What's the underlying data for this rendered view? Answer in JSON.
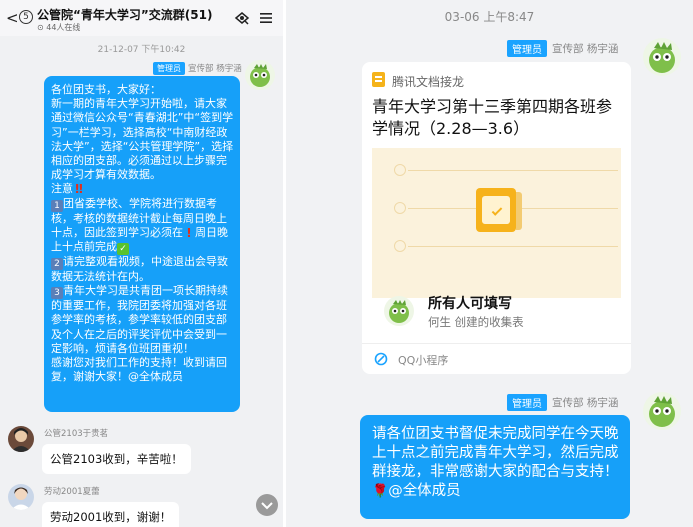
{
  "left": {
    "header": {
      "back_badge": "5",
      "group_title": "公管院“青年大学习”交流群(51)",
      "online_count": "44人在线",
      "back_glyph": "<"
    },
    "timestamp": "21-12-07 下午10:42",
    "announce": {
      "role": "管理员",
      "dept_name": "宣传部 杨宇涵",
      "greeting": "各位团支书，大家好：",
      "para1": "新一期的青年大学习开始啦，请大家通过微信公众号“青春湖北”中“签到学习”一栏学习，选择高校“中南财经政法大学”，选择“公共管理学院”，选择相应的团支部。必须通过以上步骤完成学习才算有效数据。",
      "notice_label": "注意",
      "item1": "团省委学校、学院将进行数据考核，考核的数据统计截止每周日晚上十点，因此签到学习必须在",
      "item1_tail": "周日晚上十点前完成",
      "item2": "请完整观看视频，中途退出会导致数据无法统计在内。",
      "item3": "青年大学习是共青团一项长期持续的重要工作，我院团委将加强对各班参学率的考核，参学率较低的团支部及个人在之后的评奖评优中会受到一定影响，烦请各位班团重视！",
      "thanks": "感谢您对我们工作的支持！收到请回复，谢谢大家！@全体成员",
      "n1": "1",
      "n2": "2",
      "n3": "3"
    },
    "messages": [
      {
        "name": "公管2103于贵茗",
        "text": "公管2103收到，辛苦啦！"
      },
      {
        "name": "劳动2001夏蕾",
        "text": "劳动2001收到，谢谢！"
      }
    ]
  },
  "right": {
    "timestamp": "03-06 上午8:47",
    "role": "管理员",
    "dept_name": "宣传部 杨宇涵",
    "card": {
      "brand": "腾讯文档接龙",
      "title": "青年大学习第十三季第四期各班参学情况（2.28—3.6）",
      "fill_label": "所有人可填写",
      "creator": "何生 创建的收集表",
      "footer": "QQ小程序"
    },
    "message": "请各位团支书督促未完成同学在今天晚上十点之前完成青年大学习，然后完成群接龙，非常感谢大家的配合与支持！",
    "mention": "@全体成员"
  },
  "colors": {
    "bubble_blue": "#16a0f9",
    "admin_badge": "#1aa3ff",
    "card_accent": "#f6b21b"
  },
  "icons": [
    "back-icon",
    "group-share-icon",
    "menu-icon",
    "avatar-icon",
    "doc-icon",
    "qq-mini-program-icon",
    "scroll-down-icon"
  ]
}
